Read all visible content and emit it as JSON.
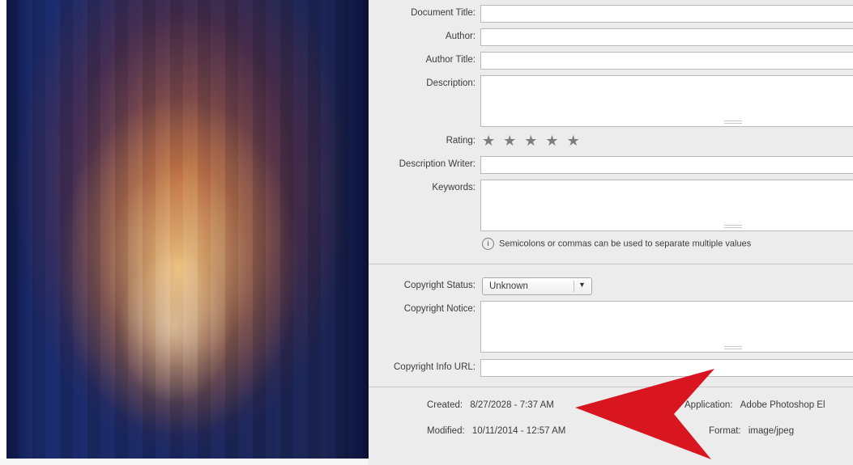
{
  "photo": {
    "alt_icon": "photo-thumbnail"
  },
  "fields": {
    "document_title": {
      "label": "Document Title:",
      "value": ""
    },
    "author": {
      "label": "Author:",
      "value": ""
    },
    "author_title": {
      "label": "Author Title:",
      "value": ""
    },
    "description": {
      "label": "Description:",
      "value": ""
    },
    "rating": {
      "label": "Rating:",
      "stars": 5,
      "filled": 0
    },
    "description_writer": {
      "label": "Description Writer:",
      "value": ""
    },
    "keywords": {
      "label": "Keywords:",
      "value": ""
    },
    "keywords_hint": "Semicolons or commas can be used to separate multiple values",
    "copyright_status": {
      "label": "Copyright Status:",
      "value": "Unknown"
    },
    "copyright_notice": {
      "label": "Copyright Notice:",
      "value": ""
    },
    "copyright_info_url": {
      "label": "Copyright Info URL:",
      "value": ""
    }
  },
  "meta": {
    "created_label": "Created:",
    "created_value": "8/27/2028 - 7:37 AM",
    "modified_label": "Modified:",
    "modified_value": "10/11/2014 - 12:57 AM",
    "application_label": "Application:",
    "application_value": "Adobe Photoshop El",
    "format_label": "Format:",
    "format_value": "image/jpeg"
  },
  "icons": {
    "info": "info-icon",
    "arrow": "red-arrow-annotation",
    "star": "star-icon",
    "dropdown": "chevron-down-icon"
  },
  "colors": {
    "arrow": "#d9161f",
    "panel_bg": "#ececec",
    "field_bg": "#ffffff"
  }
}
